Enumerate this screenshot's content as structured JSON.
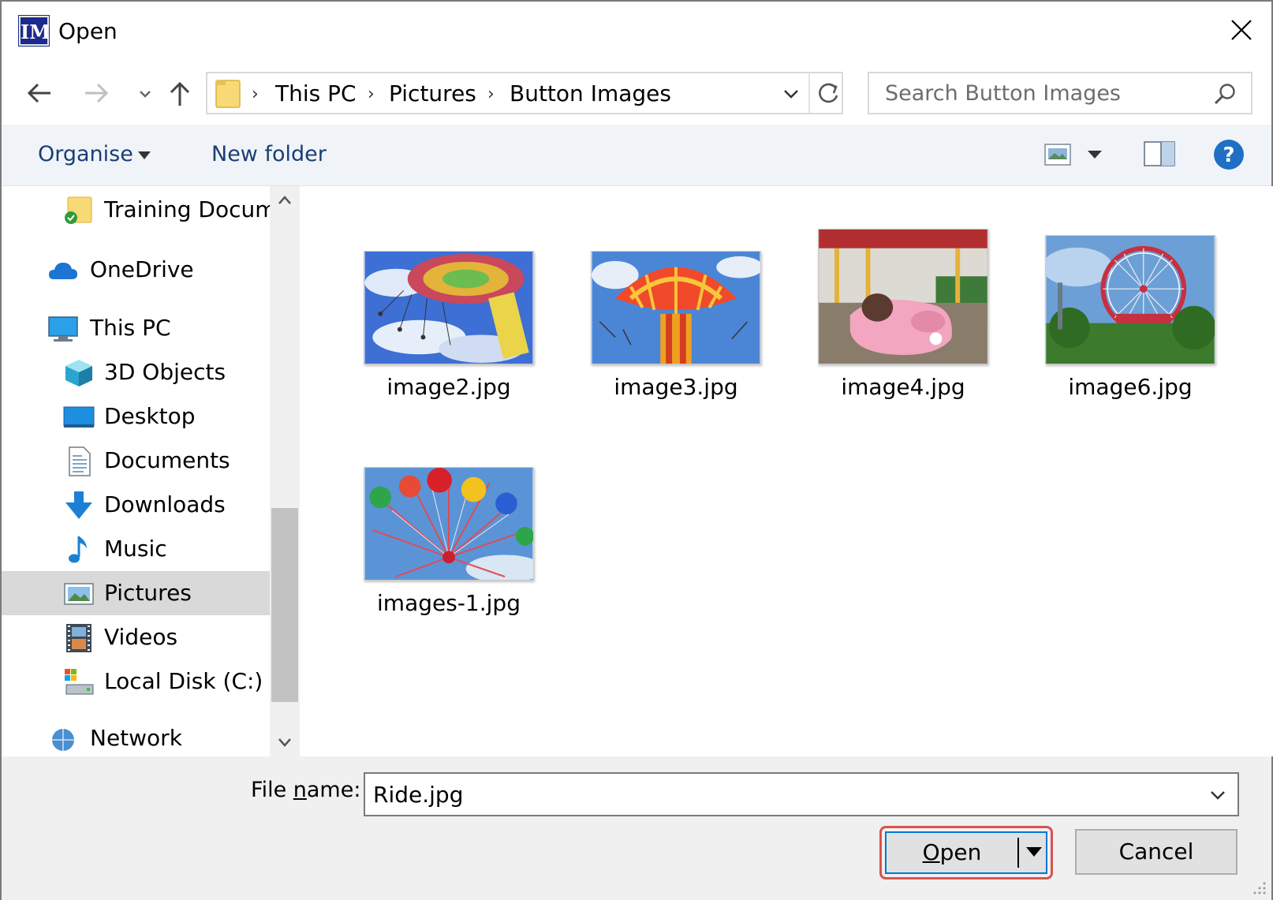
{
  "window": {
    "title": "Open",
    "app_icon_text": "IM",
    "app_icon_name": "imagemagick-app-icon",
    "close_icon": "close-icon"
  },
  "nav": {
    "back_icon": "arrow-left-icon",
    "forward_icon": "arrow-right-icon",
    "recent_icon": "chevron-down-icon",
    "up_icon": "arrow-up-icon"
  },
  "address": {
    "folder_icon": "folder-icon",
    "crumbs": [
      "This PC",
      "Pictures",
      "Button Images"
    ],
    "refresh_icon": "refresh-icon"
  },
  "search": {
    "placeholder": "Search Button Images",
    "icon": "search-icon"
  },
  "toolbar": {
    "organise": "Organise",
    "new_folder": "New folder",
    "view_icon": "view-options-icon",
    "preview_icon": "preview-pane-icon",
    "help_icon": "help-icon"
  },
  "sidebar": {
    "items": [
      {
        "label": "Training Docum",
        "icon": "shared-folder-icon"
      },
      {
        "label": "OneDrive",
        "icon": "cloud-icon"
      },
      {
        "label": "This PC",
        "icon": "computer-icon"
      },
      {
        "label": "3D Objects",
        "icon": "cube-icon"
      },
      {
        "label": "Desktop",
        "icon": "desktop-icon"
      },
      {
        "label": "Documents",
        "icon": "document-icon"
      },
      {
        "label": "Downloads",
        "icon": "download-icon"
      },
      {
        "label": "Music",
        "icon": "music-note-icon"
      },
      {
        "label": "Pictures",
        "icon": "pictures-icon",
        "selected": true
      },
      {
        "label": "Videos",
        "icon": "film-icon"
      },
      {
        "label": "Local Disk (C:)",
        "icon": "drive-icon"
      },
      {
        "label": "Network",
        "icon": "network-icon"
      }
    ]
  },
  "files": [
    {
      "name": "image2.jpg",
      "thumbnail": "swing-ride-sky"
    },
    {
      "name": "image3.jpg",
      "thumbnail": "orange-swing-carousel"
    },
    {
      "name": "image4.jpg",
      "thumbnail": "pink-car-carousel"
    },
    {
      "name": "image6.jpg",
      "thumbnail": "ferris-wheel-park"
    },
    {
      "name": "images-1.jpg",
      "thumbnail": "colorful-wheel-ride"
    }
  ],
  "footer": {
    "file_name_label": "File name:",
    "file_name_value": "Ride.jpg",
    "open_label": "Open",
    "cancel_label": "Cancel"
  },
  "colors": {
    "accent": "#0078d7",
    "highlight_border": "#d9534f",
    "link_text": "#1a3e72"
  }
}
